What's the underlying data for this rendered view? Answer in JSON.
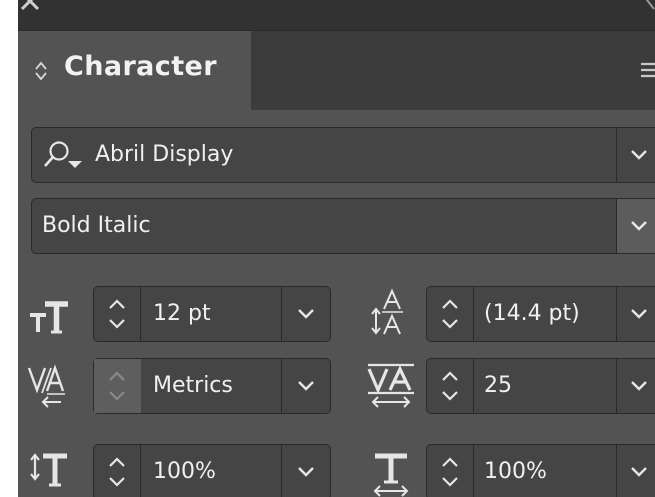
{
  "window": {
    "close_icon": "close-icon",
    "collapse_icon": "double-chevron-icon"
  },
  "tabs": [
    {
      "label": "Character",
      "icon": "updown-toggle-icon",
      "active": true
    }
  ],
  "panel_menu_icon": "hamburger-menu-icon",
  "font_family": {
    "value": "Abril Display",
    "icon": "search-dropdown-icon"
  },
  "font_style": {
    "value": "Bold Italic"
  },
  "font_size": {
    "value": "12 pt",
    "icon": "font-size-icon"
  },
  "leading": {
    "value": "(14.4 pt)",
    "icon": "leading-icon"
  },
  "kerning": {
    "value": "Metrics",
    "icon": "kerning-icon"
  },
  "tracking": {
    "value": "25",
    "icon": "tracking-icon"
  },
  "vertical_scale": {
    "value": "100%",
    "icon": "vertical-scale-icon"
  },
  "horizontal_scale": {
    "value": "100%",
    "icon": "horizontal-scale-icon"
  },
  "colors": {
    "panel": "#535353",
    "topbar": "#323232",
    "field": "#454545",
    "border": "#2a2a2a",
    "text": "#f0f0f0"
  }
}
